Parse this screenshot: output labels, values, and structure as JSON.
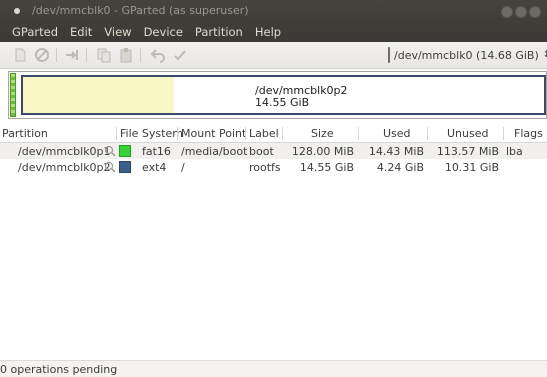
{
  "window": {
    "title": "/dev/mmcblk0 - GParted (as superuser)"
  },
  "menubar": {
    "items": [
      "GParted",
      "Edit",
      "View",
      "Device",
      "Partition",
      "Help"
    ]
  },
  "toolbar": {
    "device_selector": "/dev/mmcblk0  (14.68 GiB)",
    "icons": [
      "new-icon",
      "delete-icon",
      "resize-icon",
      "copy-icon",
      "paste-icon",
      "undo-icon",
      "apply-icon"
    ]
  },
  "disk_map": {
    "selected_partition_name": "/dev/mmcblk0p2",
    "selected_partition_size": "14.55 GiB",
    "used_fraction": 0.29
  },
  "table": {
    "columns": [
      "Partition",
      "File System",
      "Mount Point",
      "Label",
      "Size",
      "Used",
      "Unused",
      "Flags"
    ],
    "rows": [
      {
        "partition": "/dev/mmcblk0p1",
        "fs_color": "#35d435",
        "filesystem": "fat16",
        "mount": "/media/boot",
        "label": "boot",
        "size": "128.00 MiB",
        "used": "14.43 MiB",
        "unused": "113.57 MiB",
        "flags": "lba"
      },
      {
        "partition": "/dev/mmcblk0p2",
        "fs_color": "#3a5f8a",
        "filesystem": "ext4",
        "mount": "/",
        "label": "rootfs",
        "size": "14.55 GiB",
        "used": "4.24 GiB",
        "unused": "10.31 GiB",
        "flags": ""
      }
    ]
  },
  "statusbar": {
    "text": "0 operations pending"
  },
  "colors": {
    "titlebar": "#3c3b37",
    "used_space": "#f8f7c4",
    "partition_border": "#3c4b6c"
  }
}
